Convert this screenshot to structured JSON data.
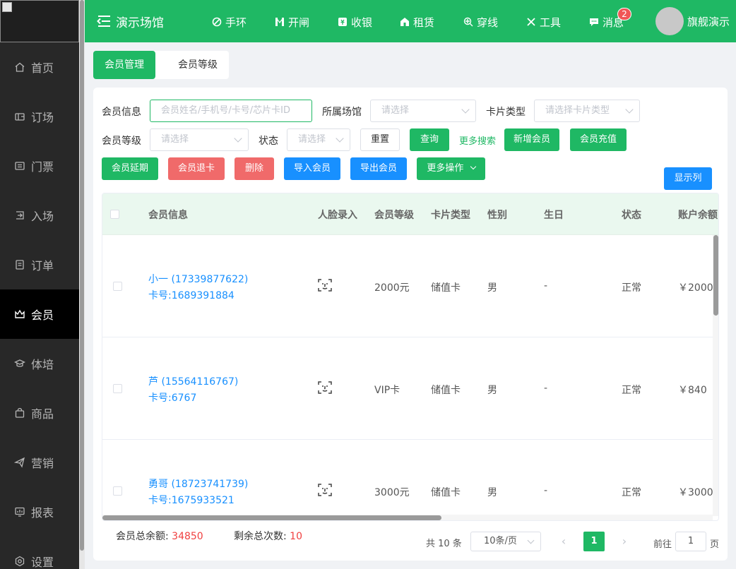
{
  "sidebar": {
    "items": [
      {
        "label": "首页",
        "icon": "home-icon"
      },
      {
        "label": "订场",
        "icon": "court-icon"
      },
      {
        "label": "门票",
        "icon": "ticket-icon"
      },
      {
        "label": "入场",
        "icon": "enter-icon"
      },
      {
        "label": "订单",
        "icon": "order-icon"
      },
      {
        "label": "会员",
        "icon": "crown-icon",
        "active": true
      },
      {
        "label": "体培",
        "icon": "training-icon"
      },
      {
        "label": "商品",
        "icon": "goods-icon"
      },
      {
        "label": "营销",
        "icon": "marketing-icon"
      },
      {
        "label": "报表",
        "icon": "report-icon"
      },
      {
        "label": "设置",
        "icon": "settings-icon"
      }
    ]
  },
  "topbar": {
    "venue": "演示场馆",
    "items": [
      {
        "label": "手环",
        "icon": "wristband-icon"
      },
      {
        "label": "开闸",
        "icon": "gate-icon"
      },
      {
        "label": "收银",
        "icon": "cashier-icon"
      },
      {
        "label": "租赁",
        "icon": "rent-icon"
      },
      {
        "label": "穿线",
        "icon": "string-icon"
      },
      {
        "label": "工具",
        "icon": "tools-icon"
      },
      {
        "label": "消息",
        "icon": "message-icon"
      }
    ],
    "message_count": "2",
    "user": "旗舰演示"
  },
  "tabs": [
    {
      "label": "会员管理",
      "active": true
    },
    {
      "label": "会员等级",
      "active": false
    }
  ],
  "filters": {
    "member_info_label": "会员信息",
    "member_info_placeholder": "会员姓名/手机号/卡号/芯片卡ID",
    "venue_label": "所属场馆",
    "venue_placeholder": "请选择",
    "card_type_label": "卡片类型",
    "card_type_placeholder": "请选择卡片类型",
    "level_label": "会员等级",
    "level_placeholder": "请选择",
    "status_label": "状态",
    "status_placeholder": "请选择"
  },
  "actions": {
    "reset": "重置",
    "query": "查询",
    "more_search": "更多搜索",
    "add_member": "新增会员",
    "recharge": "会员充值",
    "extend": "会员延期",
    "refund": "会员退卡",
    "delete": "删除",
    "import": "导入会员",
    "export": "导出会员",
    "more_ops": "更多操作",
    "show_columns": "显示列"
  },
  "table": {
    "columns": [
      "会员信息",
      "人脸录入",
      "会员等级",
      "卡片类型",
      "性别",
      "生日",
      "状态",
      "账户余额"
    ],
    "rows": [
      {
        "name": "小一 (17339877622)",
        "card": "卡号:1689391884",
        "level": "2000元",
        "card_type": "储值卡",
        "gender": "男",
        "birthday": "-",
        "status": "正常",
        "balance": "￥2000"
      },
      {
        "name": "芦 (15564116767)",
        "card": "卡号:6767",
        "level": "VIP卡",
        "card_type": "储值卡",
        "gender": "男",
        "birthday": "-",
        "status": "正常",
        "balance": "￥840"
      },
      {
        "name": "勇哥 (18723741739)",
        "card": "卡号:1675933521",
        "level": "3000元",
        "card_type": "储值卡",
        "gender": "男",
        "birthday": "-",
        "status": "正常",
        "balance": "￥3000"
      }
    ]
  },
  "summary": {
    "total_balance_label": "会员总余额:",
    "total_balance": "34850",
    "remaining_label": "剩余总次数:",
    "remaining": "10"
  },
  "pager": {
    "total": "共 10 条",
    "page_size": "10条/页",
    "current": "1",
    "goto_label": "前往",
    "goto_value": "1",
    "page_unit": "页"
  },
  "colors": {
    "brand_green": "#1fb864",
    "danger_red": "#f06a6a",
    "primary_blue": "#1890ff",
    "sidebar_bg": "#282828"
  }
}
